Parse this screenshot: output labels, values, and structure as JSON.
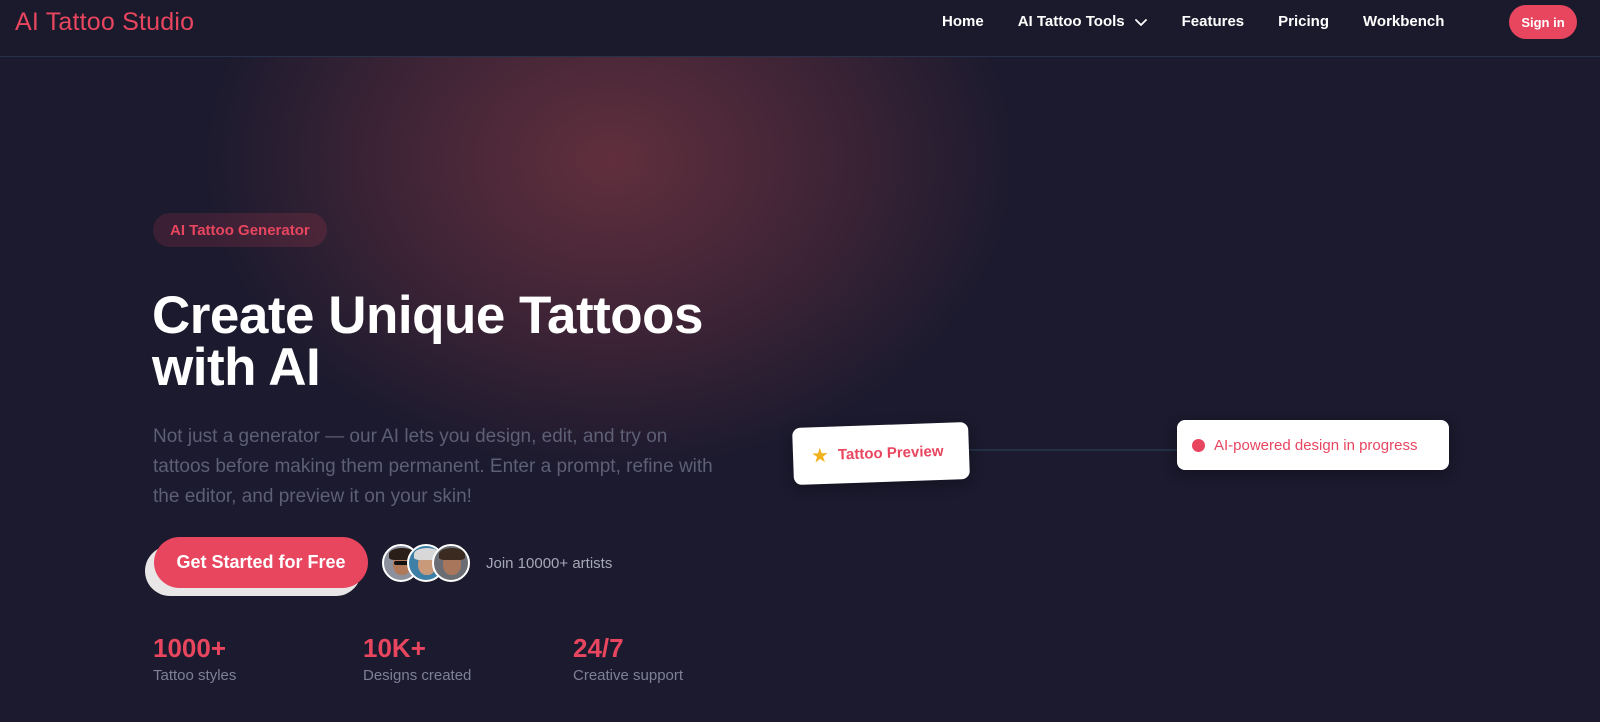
{
  "nav": {
    "logo": "AI Tattoo Studio",
    "links": [
      "Home",
      "AI Tattoo Tools",
      "Features",
      "Pricing",
      "Workbench"
    ],
    "signin": "Sign in"
  },
  "hero": {
    "badge": "AI Tattoo Generator",
    "headline_line1": "Create Unique Tattoos",
    "headline_line2": "with AI",
    "subtext": "Not just a generator — our AI lets you design, edit, and try on tattoos before making them permanent. Enter a prompt, refine with the editor, and preview it on your skin!",
    "cta": "Get Started for Free",
    "join": "Join 10000+ artists",
    "stats": [
      {
        "value": "1000+",
        "label": "Tattoo styles"
      },
      {
        "value": "10K+",
        "label": "Designs created"
      },
      {
        "value": "24/7",
        "label": "Creative support"
      }
    ]
  },
  "preview": {
    "card_label": "Tattoo Preview",
    "card_icon": "star-icon",
    "status": "AI-powered design in progress"
  },
  "colors": {
    "accent": "#e8455f",
    "background": "#1b1a2e",
    "star": "#f2b21c"
  }
}
